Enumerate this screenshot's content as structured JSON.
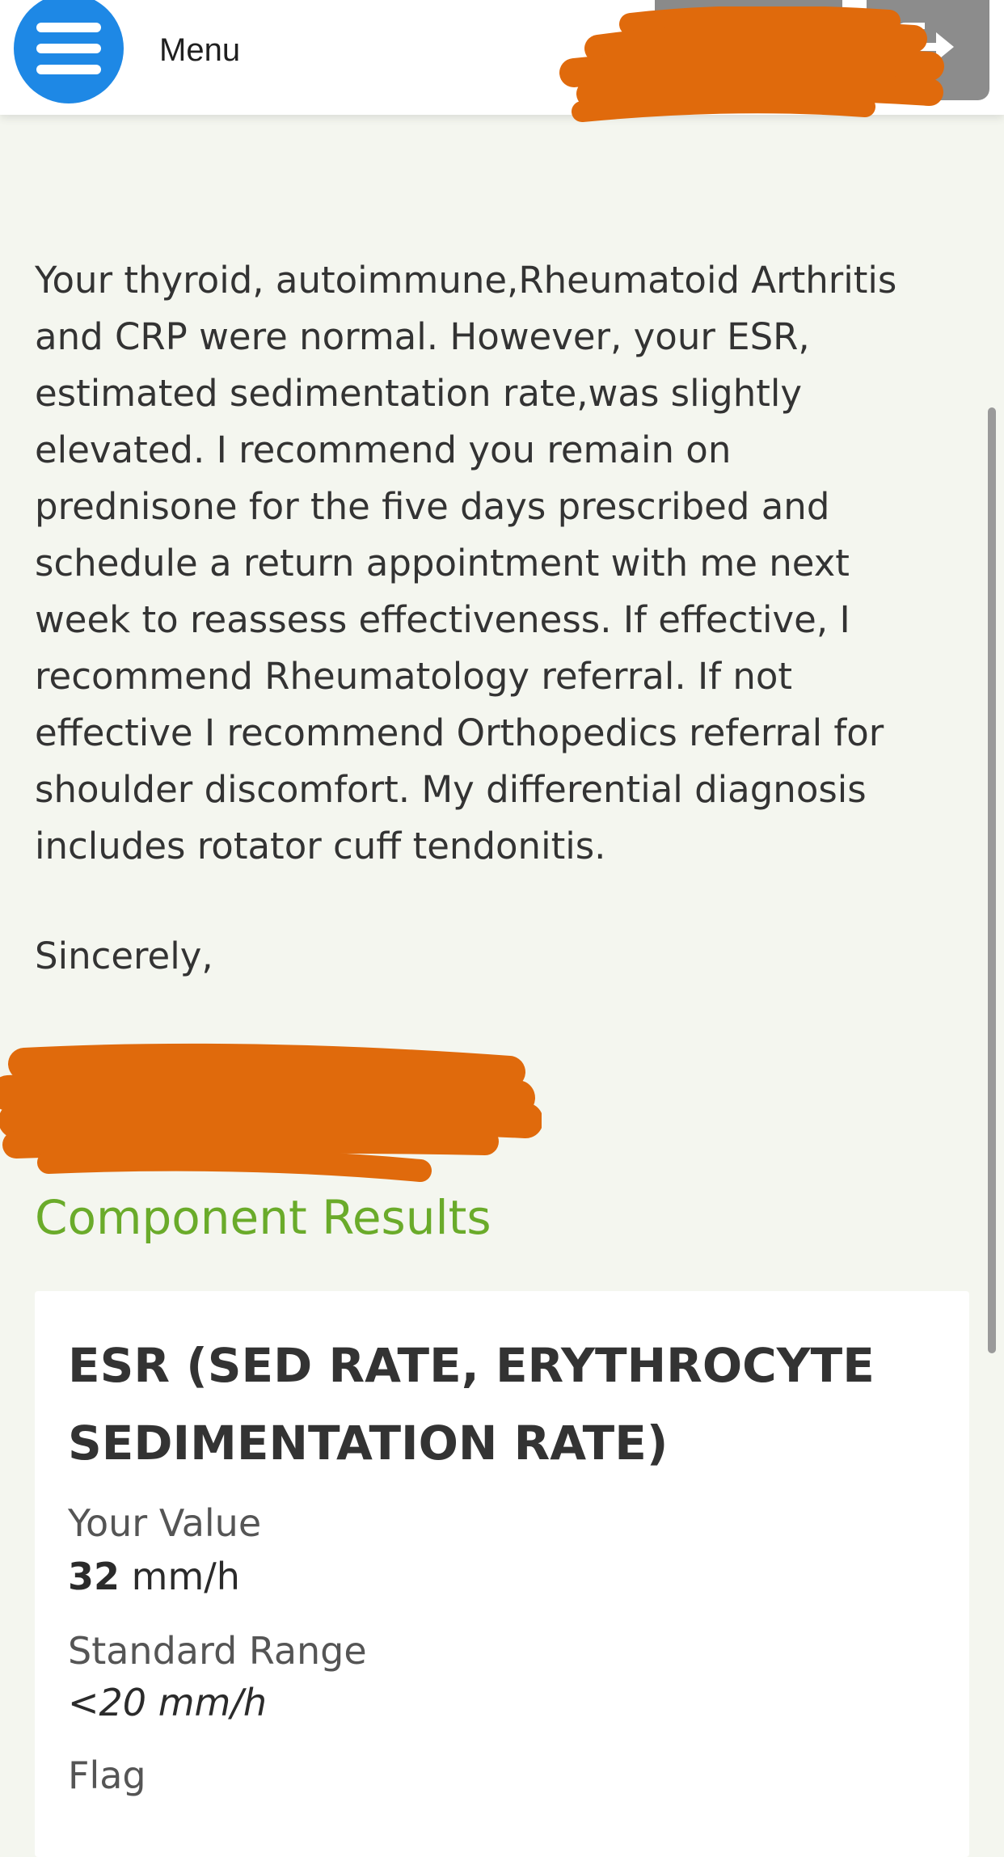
{
  "header": {
    "menu_label": "Menu",
    "menu_icon": "hamburger-icon",
    "logout_icon": "logout-icon"
  },
  "message": {
    "body": "Your thyroid, autoimmune,Rheumatoid Arthritis\nand CRP were normal. However, your ESR,\nestimated sedimentation rate,was slightly\nelevated. I recommend you remain on\nprednisone for the five days prescribed and\nschedule a return appointment with me next\nweek to reassess effectiveness. If effective, I\nrecommend Rheumatology referral. If not\neffective I recommend Orthopedics referral for\nshoulder discomfort. My differential diagnosis\nincludes rotator cuff tendonitis.",
    "signoff": "Sincerely,"
  },
  "results": {
    "section_title": "Component Results",
    "component": {
      "name": "ESR (SED RATE, ERYTHROCYTE SEDIMENTATION RATE)",
      "your_value_label": "Your Value",
      "value_number": "32",
      "value_unit": " mm/h",
      "standard_range_label": "Standard Range",
      "standard_range": "<20 mm/h",
      "flag_label": "Flag"
    }
  },
  "colors": {
    "accent_green": "#6aab2a",
    "menu_blue": "#1e88e5",
    "redaction_orange": "#e06a0c",
    "background": "#f4f6ef"
  }
}
